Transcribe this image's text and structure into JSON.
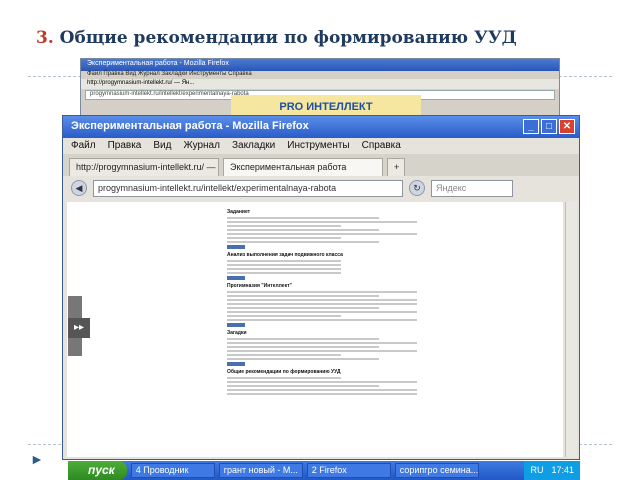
{
  "slide": {
    "number": "3.",
    "title": "Общие рекомендации по формированию УУД"
  },
  "bg_window": {
    "title": "Экспериментальная работа - Mozilla Firefox",
    "menu": "Файл  Правка  Вид  Журнал  Закладки  Инструменты  Справка",
    "tab": "http://progymnasium-intellekt.ru/ — Ян...",
    "url": "progymnasium-intellekt.ru/intellekt/experimentalnaya-rabota",
    "banner": "PRO ИНТЕЛЛЕКТ"
  },
  "window": {
    "title": "Экспериментальная работа - Mozilla Firefox",
    "buttons": {
      "minimize": "_",
      "maximize": "□",
      "close": "✕"
    },
    "menu": [
      "Файл",
      "Правка",
      "Вид",
      "Журнал",
      "Закладки",
      "Инструменты",
      "Справка"
    ],
    "tabs": [
      "http://progymnasium-intellekt.ru/ — Янд...",
      "Экспериментальная работа"
    ],
    "new_tab": "+",
    "url": "progymnasium-intellekt.ru/intellekt/experimentalnaya-rabota",
    "search_placeholder": "Яндекс"
  },
  "page_content": {
    "headings": [
      "Заданиет",
      "Анализ выполнения задач подвижного класса",
      "Прогимназия \"Интеллект\"",
      "Загадки",
      "Общие рекомендации по формированию УУД"
    ]
  },
  "taskbar": {
    "start": "пуск",
    "tasks": [
      "4 Проводник",
      "грант новый - М...",
      "2 Firefox",
      "сорипгро семина..."
    ],
    "lang": "RU",
    "time": "17:41"
  }
}
